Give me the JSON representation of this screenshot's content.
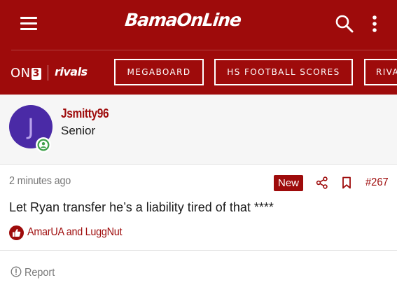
{
  "header": {
    "logo_text": "BamaOnLine",
    "icons": {
      "menu": "hamburger-menu-icon",
      "search": "search-icon",
      "more": "vertical-ellipsis-icon"
    }
  },
  "navbar": {
    "brand_on": "ON",
    "brand_three": "3",
    "brand_rivals": "rivals",
    "buttons": [
      {
        "label": "MEGABOARD"
      },
      {
        "label": "HS FOOTBALL SCORES"
      },
      {
        "label": "RIVALS"
      }
    ]
  },
  "user": {
    "avatar_initial": "J",
    "username": "Jsmitty96",
    "title": "Senior",
    "status_icon": "online-person-icon"
  },
  "post": {
    "time": "2 minutes ago",
    "new_badge": "New",
    "number": "#267",
    "body": "Let Ryan transfer he’s a liability tired of that ****",
    "reactions": "AmarUA and LuggNut",
    "report_label": "Report"
  },
  "colors": {
    "brand": "#9e0b0b",
    "avatar_bg": "#4a2aa6",
    "online": "#3fa14a",
    "muted_text": "#777777"
  }
}
